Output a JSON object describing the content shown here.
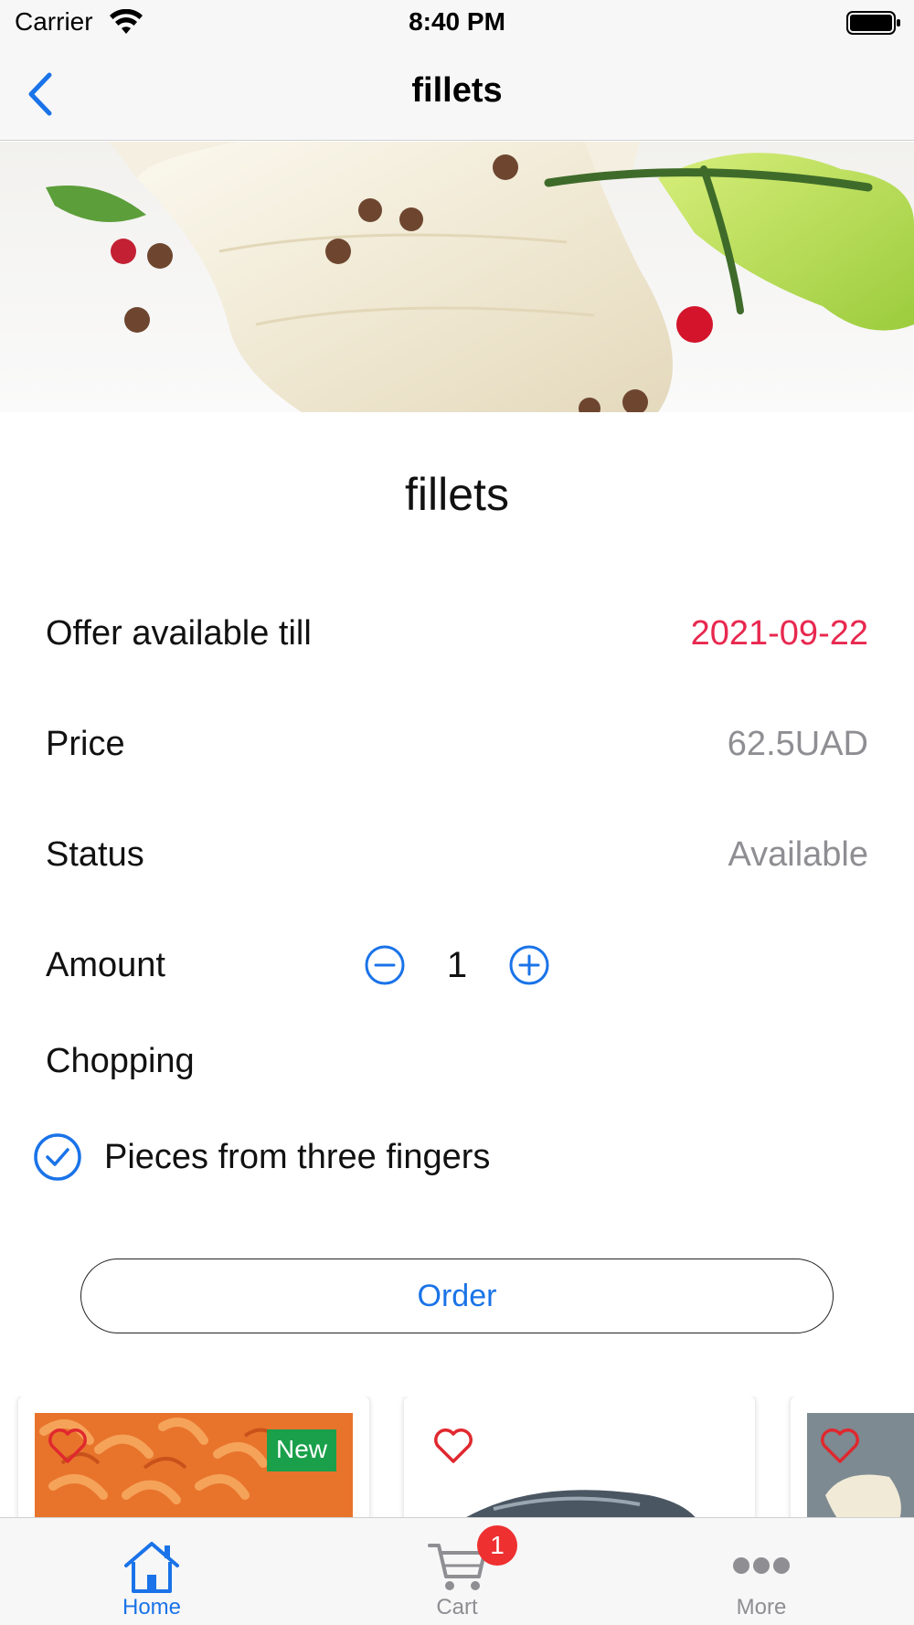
{
  "status_bar": {
    "carrier": "Carrier",
    "time": "8:40 PM"
  },
  "nav": {
    "title": "fillets"
  },
  "product": {
    "title": "fillets",
    "offer_label": "Offer available till",
    "offer_date": "2021-09-22",
    "price_label": "Price",
    "price_value": "62.5UAD",
    "status_label": "Status",
    "status_value": "Available",
    "amount_label": "Amount",
    "amount_value": "1",
    "chopping_label": "Chopping",
    "chopping_option": "Pieces from three fingers",
    "order_label": "Order"
  },
  "cards": [
    {
      "badge": "New"
    }
  ],
  "tabs": [
    {
      "label": "Home",
      "icon": "home-icon",
      "active": true
    },
    {
      "label": "Cart",
      "icon": "cart-icon",
      "badge": "1"
    },
    {
      "label": "More",
      "icon": "more-icon"
    }
  ],
  "colors": {
    "accent": "#1a73e8",
    "date_red": "#e8284f",
    "badge_green": "#1aa04a",
    "badge_red": "#ee3030",
    "heart_red": "#e0282f"
  }
}
